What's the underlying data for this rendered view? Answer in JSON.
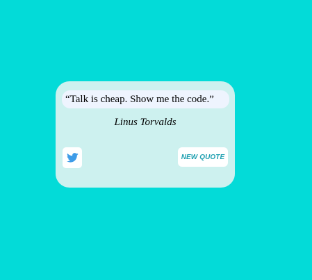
{
  "quote": {
    "text": "“Talk is cheap. Show me the code.”",
    "author": "Linus Torvalds"
  },
  "actions": {
    "tweet_icon": "twitter-icon",
    "new_quote_label": "NEW QUOTE"
  },
  "colors": {
    "background": "#03dbd8",
    "card": "#cdf1ef",
    "quote_box": "#eef4fe",
    "accent": "#1d9fb0",
    "twitter_blue": "#3e9ce8"
  }
}
